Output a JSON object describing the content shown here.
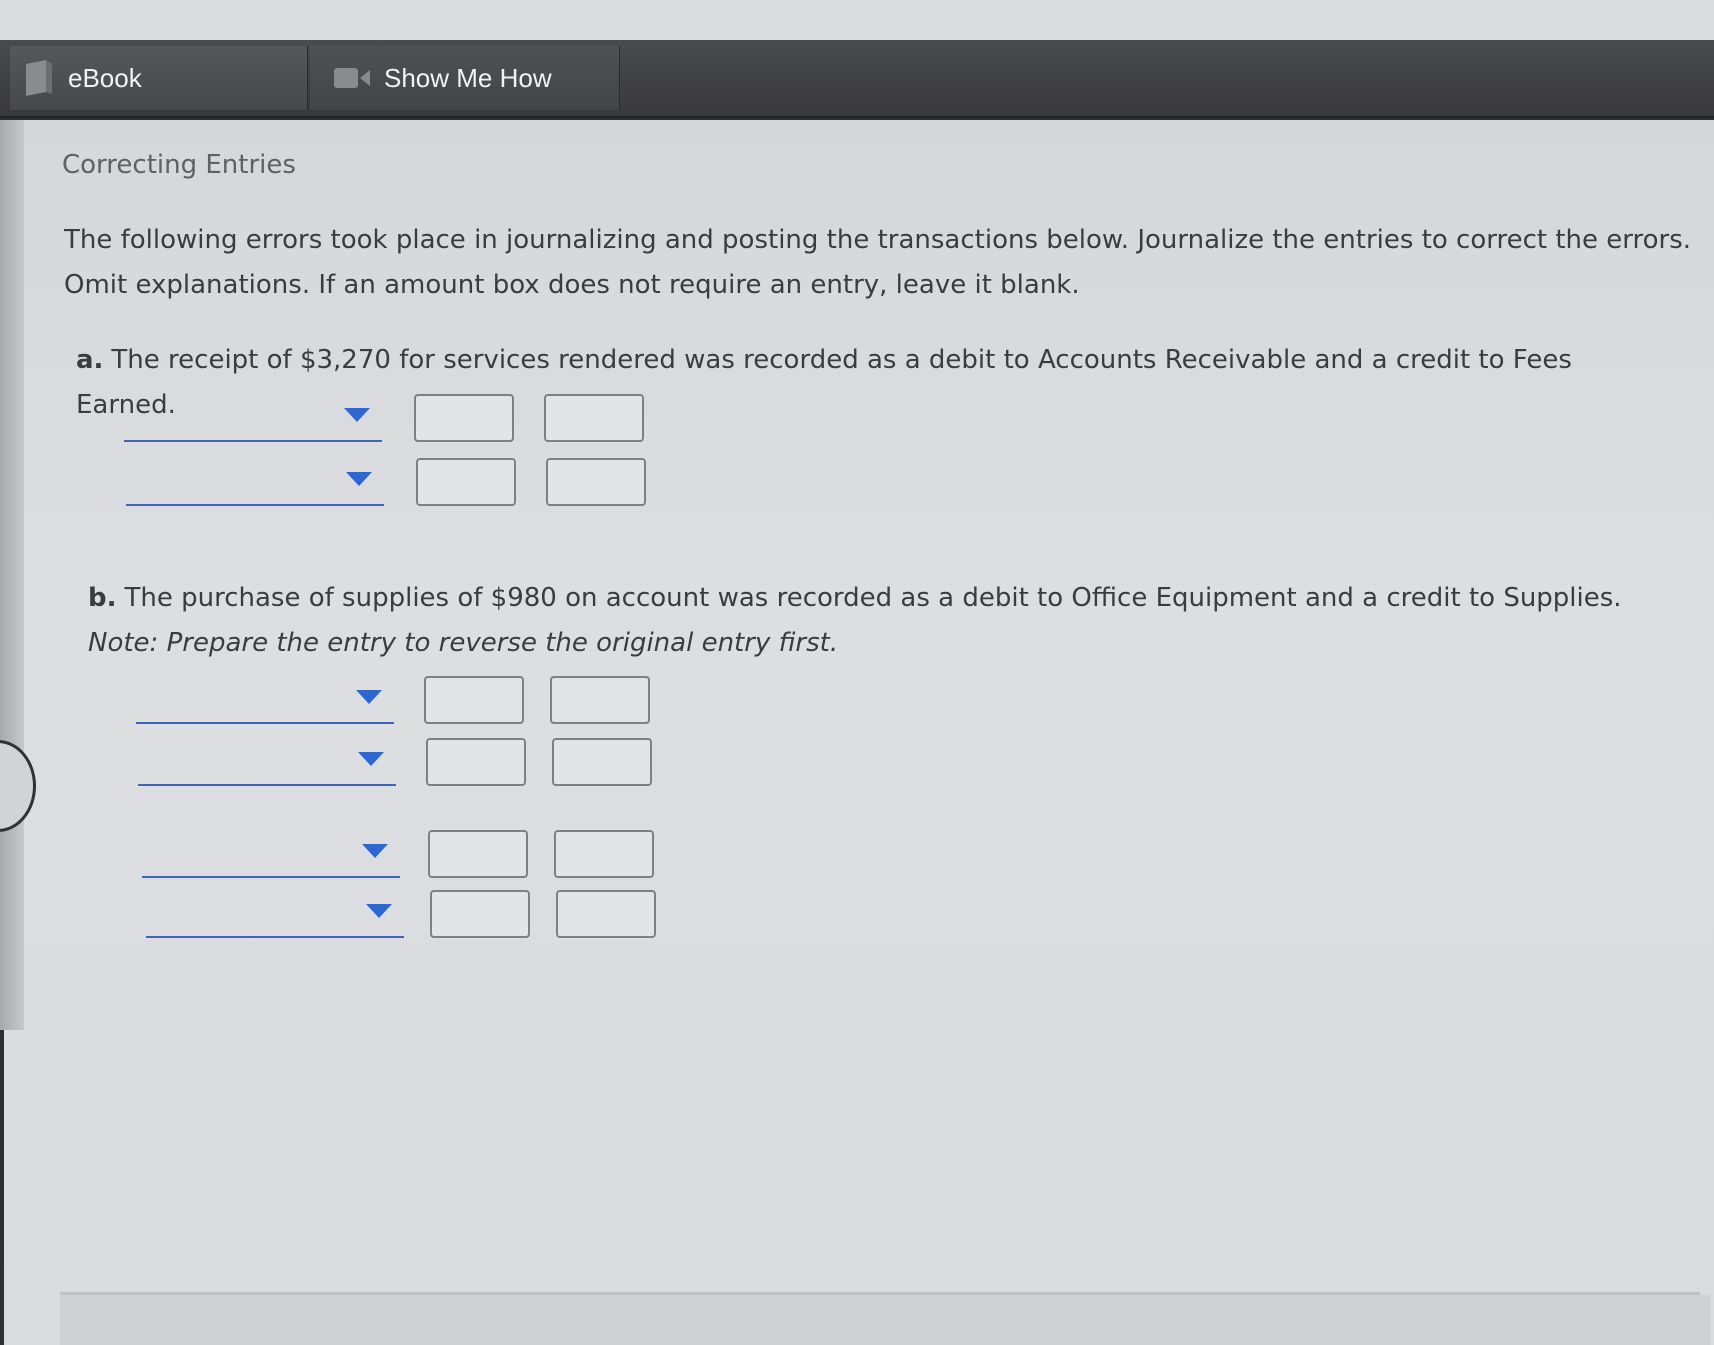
{
  "toolbar": {
    "ebook_label": "eBook",
    "show_me_how_label": "Show Me How"
  },
  "problem": {
    "title": "Correcting Entries",
    "instructions": "The following errors took place in journalizing and posting the transactions below. Journalize the entries to correct the errors. Omit explanations. If an amount box does not require an entry, leave it blank.",
    "part_a": {
      "letter": "a.",
      "text": "The receipt of $3,270 for services rendered was recorded as a debit to Accounts Receivable and a credit to Fees Earned."
    },
    "part_b": {
      "letter": "b.",
      "text": "The purchase of supplies of $980 on account was recorded as a debit to Office Equipment and a credit to Supplies.",
      "note_label": "Note:",
      "note_text": "Prepare the entry to reverse the original entry first."
    }
  },
  "colors": {
    "toolbar": "#404144",
    "caret": "#2e67cf",
    "underline": "#3f64b8",
    "content_bg": "#d9dbde"
  },
  "icons": [
    "ebook-icon",
    "video-icon",
    "dropdown-caret-icon"
  ]
}
